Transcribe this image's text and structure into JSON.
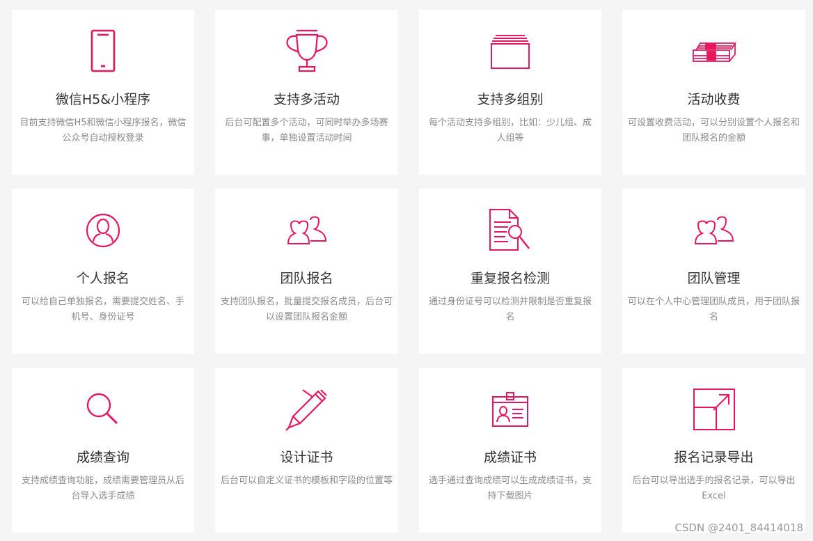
{
  "accent_color": "#e8175d",
  "cards": [
    {
      "title": "微信H5&小程序",
      "desc": "目前支持微信H5和微信小程序报名，微信公众号自动授权登录",
      "icon": "phone-icon"
    },
    {
      "title": "支持多活动",
      "desc": "后台可配置多个活动，可同时举办多场赛事，单独设置活动时间",
      "icon": "trophy-icon"
    },
    {
      "title": "支持多组别",
      "desc": "每个活动支持多组别，比如：少儿组、成人组等",
      "icon": "folder-stack-icon"
    },
    {
      "title": "活动收费",
      "desc": "可设置收费活动，可以分别设置个人报名和团队报名的金额",
      "icon": "money-stack-icon"
    },
    {
      "title": "个人报名",
      "desc": "可以给自己单独报名，需要提交姓名、手机号、身份证号",
      "icon": "user-circle-icon"
    },
    {
      "title": "团队报名",
      "desc": "支持团队报名，批量提交报名成员，后台可以设置团队报名金额",
      "icon": "users-icon"
    },
    {
      "title": "重复报名检测",
      "desc": "通过身份证号可以检测并限制是否重复报名",
      "icon": "document-search-icon"
    },
    {
      "title": "团队管理",
      "desc": "可以在个人中心管理团队成员，用于团队报名",
      "icon": "users-icon"
    },
    {
      "title": "成绩查询",
      "desc": "支持成绩查询功能，成绩需要管理员从后台导入选手成绩",
      "icon": "search-icon"
    },
    {
      "title": "设计证书",
      "desc": "后台可以自定义证书的模板和字段的位置等",
      "icon": "pen-icon"
    },
    {
      "title": "成绩证书",
      "desc": "选手通过查询成绩可以生成成绩证书，支持下载图片",
      "icon": "id-card-icon"
    },
    {
      "title": "报名记录导出",
      "desc": "后台可以导出选手的报名记录，可以导出Excel",
      "icon": "export-icon"
    }
  ],
  "watermark": "CSDN @2401_84414018"
}
